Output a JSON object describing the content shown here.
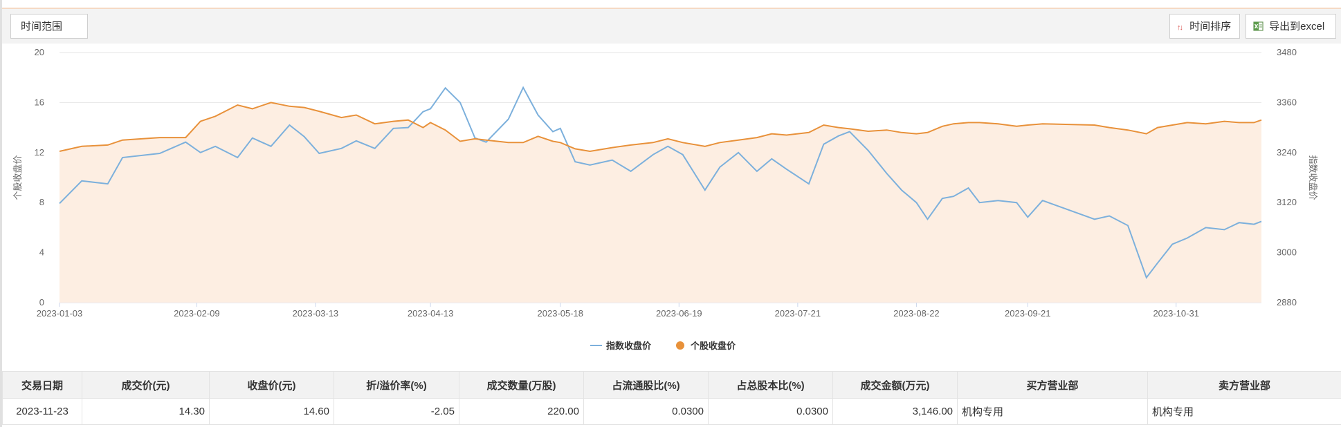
{
  "toolbar": {
    "time_range_label": "时间范围",
    "sort_label": "时间排序",
    "export_label": "导出到excel"
  },
  "colors": {
    "index_series": "#7cb0dc",
    "stock_series": "#e8913a",
    "area_fill": "#fdeee2",
    "grid": "#e6e6e6"
  },
  "chart_data": {
    "type": "line",
    "ylabel_left": "个股收盘价",
    "ylabel_right": "指数收盘价",
    "ylim_left": [
      0,
      20
    ],
    "ylim_right": [
      2880,
      3480
    ],
    "yticks_left": [
      "0",
      "4",
      "8",
      "12",
      "16",
      "20"
    ],
    "yticks_right": [
      "2880",
      "3000",
      "3120",
      "3240",
      "3360",
      "3480"
    ],
    "xticks": [
      "2023-01-03",
      "2023-02-09",
      "2023-03-13",
      "2023-04-13",
      "2023-05-18",
      "2023-06-19",
      "2023-07-21",
      "2023-08-22",
      "2023-09-21",
      "2023-10-31"
    ],
    "x_range": [
      "2023-01-03",
      "2023-11-23"
    ],
    "legend": "bottom-center",
    "series": [
      {
        "name": "指数收盘价",
        "axis": "right",
        "points": [
          [
            "2023-01-03",
            3118
          ],
          [
            "2023-01-09",
            3172
          ],
          [
            "2023-01-16",
            3165
          ],
          [
            "2023-01-20",
            3228
          ],
          [
            "2023-01-30",
            3238
          ],
          [
            "2023-02-06",
            3265
          ],
          [
            "2023-02-10",
            3240
          ],
          [
            "2023-02-14",
            3255
          ],
          [
            "2023-02-20",
            3228
          ],
          [
            "2023-02-24",
            3275
          ],
          [
            "2023-03-01",
            3255
          ],
          [
            "2023-03-06",
            3306
          ],
          [
            "2023-03-10",
            3278
          ],
          [
            "2023-03-14",
            3238
          ],
          [
            "2023-03-20",
            3250
          ],
          [
            "2023-03-24",
            3268
          ],
          [
            "2023-03-29",
            3250
          ],
          [
            "2023-04-03",
            3298
          ],
          [
            "2023-04-07",
            3300
          ],
          [
            "2023-04-11",
            3338
          ],
          [
            "2023-04-13",
            3345
          ],
          [
            "2023-04-17",
            3395
          ],
          [
            "2023-04-21",
            3360
          ],
          [
            "2023-04-25",
            3275
          ],
          [
            "2023-04-28",
            3265
          ],
          [
            "2023-05-04",
            3320
          ],
          [
            "2023-05-08",
            3396
          ],
          [
            "2023-05-12",
            3330
          ],
          [
            "2023-05-16",
            3290
          ],
          [
            "2023-05-18",
            3298
          ],
          [
            "2023-05-22",
            3218
          ],
          [
            "2023-05-26",
            3210
          ],
          [
            "2023-06-01",
            3222
          ],
          [
            "2023-06-06",
            3195
          ],
          [
            "2023-06-12",
            3235
          ],
          [
            "2023-06-16",
            3255
          ],
          [
            "2023-06-20",
            3235
          ],
          [
            "2023-06-26",
            3150
          ],
          [
            "2023-06-30",
            3205
          ],
          [
            "2023-07-05",
            3240
          ],
          [
            "2023-07-10",
            3195
          ],
          [
            "2023-07-14",
            3225
          ],
          [
            "2023-07-18",
            3200
          ],
          [
            "2023-07-24",
            3165
          ],
          [
            "2023-07-28",
            3260
          ],
          [
            "2023-08-01",
            3280
          ],
          [
            "2023-08-04",
            3290
          ],
          [
            "2023-08-09",
            3245
          ],
          [
            "2023-08-14",
            3190
          ],
          [
            "2023-08-18",
            3150
          ],
          [
            "2023-08-22",
            3120
          ],
          [
            "2023-08-25",
            3080
          ],
          [
            "2023-08-29",
            3130
          ],
          [
            "2023-09-01",
            3135
          ],
          [
            "2023-09-05",
            3155
          ],
          [
            "2023-09-08",
            3120
          ],
          [
            "2023-09-13",
            3125
          ],
          [
            "2023-09-18",
            3120
          ],
          [
            "2023-09-21",
            3085
          ],
          [
            "2023-09-25",
            3125
          ],
          [
            "2023-10-09",
            3080
          ],
          [
            "2023-10-13",
            3088
          ],
          [
            "2023-10-18",
            3065
          ],
          [
            "2023-10-23",
            2940
          ],
          [
            "2023-10-26",
            2975
          ],
          [
            "2023-10-30",
            3020
          ],
          [
            "2023-11-03",
            3035
          ],
          [
            "2023-11-08",
            3060
          ],
          [
            "2023-11-13",
            3055
          ],
          [
            "2023-11-17",
            3072
          ],
          [
            "2023-11-21",
            3068
          ],
          [
            "2023-11-23",
            3075
          ]
        ]
      },
      {
        "name": "个股收盘价",
        "axis": "left",
        "points": [
          [
            "2023-01-03",
            12.1
          ],
          [
            "2023-01-09",
            12.5
          ],
          [
            "2023-01-16",
            12.6
          ],
          [
            "2023-01-20",
            13.0
          ],
          [
            "2023-01-30",
            13.2
          ],
          [
            "2023-02-06",
            13.2
          ],
          [
            "2023-02-10",
            14.5
          ],
          [
            "2023-02-14",
            14.9
          ],
          [
            "2023-02-20",
            15.8
          ],
          [
            "2023-02-24",
            15.5
          ],
          [
            "2023-03-01",
            16.0
          ],
          [
            "2023-03-06",
            15.7
          ],
          [
            "2023-03-10",
            15.6
          ],
          [
            "2023-03-14",
            15.3
          ],
          [
            "2023-03-20",
            14.8
          ],
          [
            "2023-03-24",
            15.0
          ],
          [
            "2023-03-29",
            14.3
          ],
          [
            "2023-04-03",
            14.5
          ],
          [
            "2023-04-07",
            14.6
          ],
          [
            "2023-04-11",
            14.0
          ],
          [
            "2023-04-13",
            14.4
          ],
          [
            "2023-04-17",
            13.8
          ],
          [
            "2023-04-21",
            12.9
          ],
          [
            "2023-04-25",
            13.1
          ],
          [
            "2023-04-28",
            13.0
          ],
          [
            "2023-05-04",
            12.8
          ],
          [
            "2023-05-08",
            12.8
          ],
          [
            "2023-05-12",
            13.3
          ],
          [
            "2023-05-16",
            12.9
          ],
          [
            "2023-05-18",
            12.8
          ],
          [
            "2023-05-22",
            12.3
          ],
          [
            "2023-05-26",
            12.1
          ],
          [
            "2023-06-01",
            12.4
          ],
          [
            "2023-06-06",
            12.6
          ],
          [
            "2023-06-12",
            12.8
          ],
          [
            "2023-06-16",
            13.1
          ],
          [
            "2023-06-20",
            12.8
          ],
          [
            "2023-06-26",
            12.5
          ],
          [
            "2023-06-30",
            12.8
          ],
          [
            "2023-07-05",
            13.0
          ],
          [
            "2023-07-10",
            13.2
          ],
          [
            "2023-07-14",
            13.5
          ],
          [
            "2023-07-18",
            13.4
          ],
          [
            "2023-07-24",
            13.6
          ],
          [
            "2023-07-28",
            14.2
          ],
          [
            "2023-08-01",
            14.0
          ],
          [
            "2023-08-04",
            13.9
          ],
          [
            "2023-08-09",
            13.7
          ],
          [
            "2023-08-14",
            13.8
          ],
          [
            "2023-08-18",
            13.6
          ],
          [
            "2023-08-22",
            13.5
          ],
          [
            "2023-08-25",
            13.6
          ],
          [
            "2023-08-29",
            14.1
          ],
          [
            "2023-09-01",
            14.3
          ],
          [
            "2023-09-05",
            14.4
          ],
          [
            "2023-09-08",
            14.4
          ],
          [
            "2023-09-13",
            14.3
          ],
          [
            "2023-09-18",
            14.1
          ],
          [
            "2023-09-21",
            14.2
          ],
          [
            "2023-09-25",
            14.3
          ],
          [
            "2023-10-09",
            14.2
          ],
          [
            "2023-10-13",
            14.0
          ],
          [
            "2023-10-18",
            13.8
          ],
          [
            "2023-10-23",
            13.5
          ],
          [
            "2023-10-26",
            14.0
          ],
          [
            "2023-10-30",
            14.2
          ],
          [
            "2023-11-03",
            14.4
          ],
          [
            "2023-11-08",
            14.3
          ],
          [
            "2023-11-13",
            14.5
          ],
          [
            "2023-11-17",
            14.4
          ],
          [
            "2023-11-21",
            14.4
          ],
          [
            "2023-11-23",
            14.6
          ]
        ]
      }
    ]
  },
  "table": {
    "headers": [
      "交易日期",
      "成交价(元)",
      "收盘价(元)",
      "折/溢价率(%)",
      "成交数量(万股)",
      "占流通股比(%)",
      "占总股本比(%)",
      "成交金额(万元)",
      "买方营业部",
      "卖方营业部"
    ],
    "rows": [
      [
        "2023-11-23",
        "14.30",
        "14.60",
        "-2.05",
        "220.00",
        "0.0300",
        "0.0300",
        "3,146.00",
        "机构专用",
        "机构专用"
      ]
    ]
  }
}
